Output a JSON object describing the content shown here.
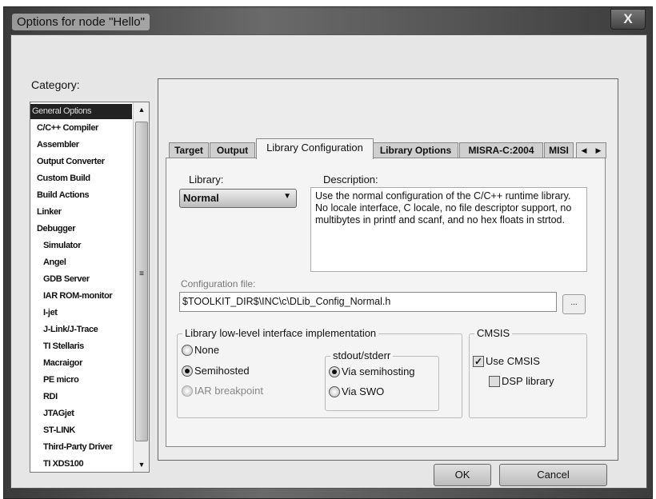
{
  "window": {
    "title": "Options for node \"Hello\"",
    "close_label": "X"
  },
  "category": {
    "label": "Category:",
    "items": [
      {
        "label": "General Options",
        "selected": true
      },
      {
        "label": "C/C++ Compiler"
      },
      {
        "label": "Assembler"
      },
      {
        "label": "Output Converter"
      },
      {
        "label": "Custom Build"
      },
      {
        "label": "Build Actions"
      },
      {
        "label": "Linker"
      },
      {
        "label": "Debugger"
      },
      {
        "label": "Simulator",
        "sub": true
      },
      {
        "label": "Angel",
        "sub": true
      },
      {
        "label": "GDB Server",
        "sub": true
      },
      {
        "label": "IAR ROM-monitor",
        "sub": true
      },
      {
        "label": "I-jet",
        "sub": true
      },
      {
        "label": "J-Link/J-Trace",
        "sub": true
      },
      {
        "label": "TI Stellaris",
        "sub": true
      },
      {
        "label": "Macraigor",
        "sub": true
      },
      {
        "label": "PE micro",
        "sub": true
      },
      {
        "label": "RDI",
        "sub": true
      },
      {
        "label": "JTAGjet",
        "sub": true
      },
      {
        "label": "ST-LINK",
        "sub": true
      },
      {
        "label": "Third-Party Driver",
        "sub": true
      },
      {
        "label": "TI XDS100",
        "sub": true
      }
    ]
  },
  "tabs": [
    {
      "label": "Target"
    },
    {
      "label": "Output"
    },
    {
      "label": "Library Configuration",
      "active": true
    },
    {
      "label": "Library Options"
    },
    {
      "label": "MISRA-C:2004"
    },
    {
      "label": "MISI"
    }
  ],
  "library": {
    "label": "Library:",
    "value": "Normal"
  },
  "description": {
    "label": "Description:",
    "text": "Use the normal configuration of the C/C++ runtime library. No locale interface, C locale, no file descriptor support, no multibytes in printf and scanf, and no hex floats in strtod."
  },
  "config_file": {
    "label": "Configuration file:",
    "value": "$TOOLKIT_DIR$\\INC\\c\\DLib_Config_Normal.h",
    "browse_label": "..."
  },
  "low_level": {
    "legend": "Library low-level interface implementation",
    "options": [
      {
        "label": "None",
        "checked": false
      },
      {
        "label": "Semihosted",
        "checked": true
      },
      {
        "label": "IAR breakpoint",
        "checked": false,
        "disabled": true
      }
    ]
  },
  "stdout": {
    "legend": "stdout/stderr",
    "options": [
      {
        "label": "Via semihosting",
        "checked": true
      },
      {
        "label": "Via SWO",
        "checked": false
      }
    ]
  },
  "cmsis": {
    "legend": "CMSIS",
    "use_cmsis": {
      "label": "Use CMSIS",
      "checked": true
    },
    "dsp": {
      "label": "DSP library",
      "checked": false
    }
  },
  "buttons": {
    "ok": "OK",
    "cancel": "Cancel"
  }
}
